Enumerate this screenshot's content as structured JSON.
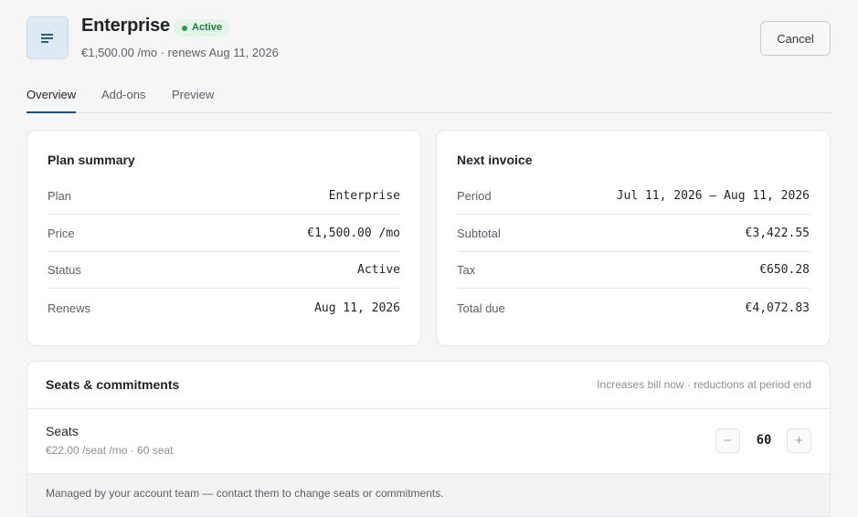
{
  "header": {
    "icon": "document-lines-icon",
    "title": "Enterprise",
    "status_badge": "Active",
    "subtitle": "€1,500.00 /mo · renews Aug 11, 2026",
    "cancel_label": "Cancel"
  },
  "tabs": [
    {
      "label": "Overview",
      "active": true
    },
    {
      "label": "Add-ons",
      "active": false
    },
    {
      "label": "Preview",
      "active": false
    }
  ],
  "plan_summary": {
    "title": "Plan summary",
    "rows": [
      {
        "label": "Plan",
        "value": "Enterprise"
      },
      {
        "label": "Price",
        "value": "€1,500.00 /mo"
      },
      {
        "label": "Status",
        "value": "Active"
      },
      {
        "label": "Renews",
        "value": "Aug 11, 2026"
      }
    ]
  },
  "next_invoice": {
    "title": "Next invoice",
    "rows": [
      {
        "label": "Period",
        "value": "Jul 11, 2026 – Aug 11, 2026"
      },
      {
        "label": "Subtotal",
        "value": "€3,422.55"
      },
      {
        "label": "Tax",
        "value": "€650.28"
      },
      {
        "label": "Total due",
        "value": "€4,072.83"
      }
    ]
  },
  "seats": {
    "title": "Seats & commitments",
    "note": "Increases bill now · reductions at period end",
    "label": "Seats",
    "sub": "€22.00 /seat /mo · 60 seat",
    "decrement": "−",
    "value": "60",
    "increment": "+",
    "managed_note": "Managed by your account team — contact them to change seats or commitments."
  },
  "colors": {
    "accent": "#1f4e79",
    "success": "#2e9a4f",
    "badge_bg": "#e3f4e8"
  }
}
